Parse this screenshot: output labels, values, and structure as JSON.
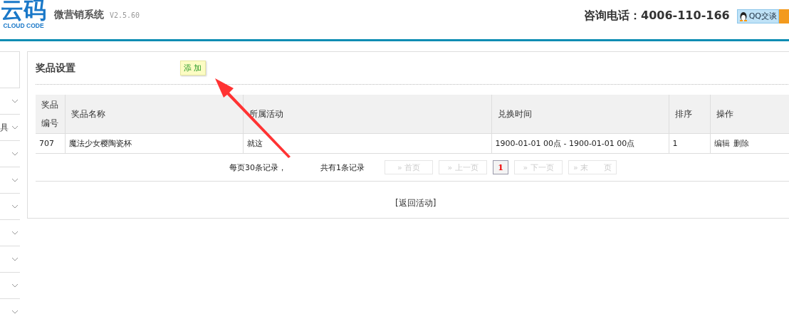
{
  "header": {
    "logo_mark": "云码",
    "logo_caption": "CLOUD CODE",
    "system_name": "微营销系统",
    "version": "V2.5.60",
    "hotline": "咨询电话：4006-110-166",
    "qq_button": "QQ交谈"
  },
  "sidebar": {
    "items": [
      {
        "expanded": false
      },
      {
        "label": "具",
        "expanded": false
      },
      {
        "expanded": false
      },
      {
        "expanded": false
      },
      {
        "expanded": false
      },
      {
        "expanded": false
      },
      {
        "expanded": false
      },
      {
        "expanded": false
      },
      {
        "expanded": false
      }
    ]
  },
  "panel": {
    "title": "奖品设置",
    "add_button": "添 加",
    "table": {
      "columns": [
        "奖品编号",
        "奖品名称",
        "所属活动",
        "兑换时间",
        "排序",
        "操作"
      ],
      "rows": [
        {
          "cells": [
            "707",
            "魔法少女樱陶瓷杯",
            "就这",
            "1900-01-01 00点 - 1900-01-01 00点",
            "1"
          ],
          "actions": [
            "编辑",
            "删除"
          ]
        }
      ]
    },
    "pagination": {
      "per_page": "每页30条记录，",
      "total": "共有1条记录",
      "buttons": [
        {
          "label": "» 首页",
          "kind": "nav",
          "disabled": true,
          "selected": false
        },
        {
          "label": "» 上一页",
          "kind": "nav",
          "disabled": true,
          "selected": false
        },
        {
          "label": "1",
          "kind": "page",
          "disabled": false,
          "selected": true
        },
        {
          "label": "» 下一页",
          "kind": "nav",
          "disabled": true,
          "selected": false
        },
        {
          "label": "» 末　　页",
          "kind": "nav",
          "disabled": true,
          "selected": false
        }
      ]
    },
    "back_link": "[返回活动]"
  }
}
